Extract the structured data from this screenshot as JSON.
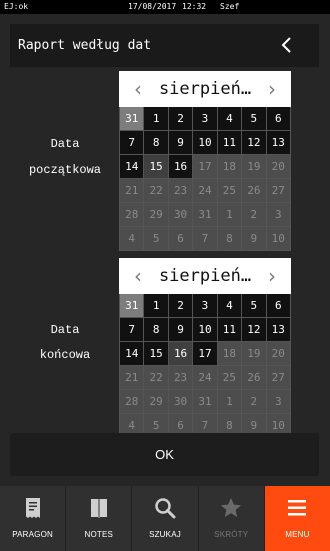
{
  "status": {
    "left": "EJ:ok",
    "date": "17/08/2017",
    "time": "12:32",
    "user": "Szef"
  },
  "header": {
    "title": "Raport według dat"
  },
  "labels": {
    "start_line1": "Data",
    "start_line2": "początkowa",
    "end_line1": "Data",
    "end_line2": "końcowa"
  },
  "calendar_start": {
    "month": "sierpień…",
    "days": [
      {
        "n": "31",
        "s": "sel"
      },
      {
        "n": "1",
        "s": "cur"
      },
      {
        "n": "2",
        "s": "cur"
      },
      {
        "n": "3",
        "s": "cur"
      },
      {
        "n": "4",
        "s": "cur"
      },
      {
        "n": "5",
        "s": "cur"
      },
      {
        "n": "6",
        "s": "cur"
      },
      {
        "n": "7",
        "s": "cur"
      },
      {
        "n": "8",
        "s": "cur"
      },
      {
        "n": "9",
        "s": "cur"
      },
      {
        "n": "10",
        "s": "cur"
      },
      {
        "n": "11",
        "s": "cur"
      },
      {
        "n": "12",
        "s": "cur"
      },
      {
        "n": "13",
        "s": "cur"
      },
      {
        "n": "14",
        "s": "cur"
      },
      {
        "n": "15",
        "s": "hl"
      },
      {
        "n": "16",
        "s": "cur"
      },
      {
        "n": "17",
        "s": "out"
      },
      {
        "n": "18",
        "s": "out"
      },
      {
        "n": "19",
        "s": "out"
      },
      {
        "n": "20",
        "s": "out"
      },
      {
        "n": "21",
        "s": "out"
      },
      {
        "n": "22",
        "s": "out"
      },
      {
        "n": "23",
        "s": "out"
      },
      {
        "n": "24",
        "s": "out"
      },
      {
        "n": "25",
        "s": "out"
      },
      {
        "n": "26",
        "s": "out"
      },
      {
        "n": "27",
        "s": "out"
      },
      {
        "n": "28",
        "s": "out"
      },
      {
        "n": "29",
        "s": "out"
      },
      {
        "n": "30",
        "s": "out"
      },
      {
        "n": "31",
        "s": "out"
      },
      {
        "n": "1",
        "s": "out"
      },
      {
        "n": "2",
        "s": "out"
      },
      {
        "n": "3",
        "s": "out"
      },
      {
        "n": "4",
        "s": "out"
      },
      {
        "n": "5",
        "s": "out"
      },
      {
        "n": "6",
        "s": "out"
      },
      {
        "n": "7",
        "s": "out"
      },
      {
        "n": "8",
        "s": "out"
      },
      {
        "n": "9",
        "s": "out"
      },
      {
        "n": "10",
        "s": "out"
      }
    ]
  },
  "calendar_end": {
    "month": "sierpień…",
    "days": [
      {
        "n": "31",
        "s": "sel"
      },
      {
        "n": "1",
        "s": "cur"
      },
      {
        "n": "2",
        "s": "cur"
      },
      {
        "n": "3",
        "s": "cur"
      },
      {
        "n": "4",
        "s": "cur"
      },
      {
        "n": "5",
        "s": "cur"
      },
      {
        "n": "6",
        "s": "cur"
      },
      {
        "n": "7",
        "s": "cur"
      },
      {
        "n": "8",
        "s": "cur"
      },
      {
        "n": "9",
        "s": "cur"
      },
      {
        "n": "10",
        "s": "cur"
      },
      {
        "n": "11",
        "s": "cur"
      },
      {
        "n": "12",
        "s": "cur"
      },
      {
        "n": "13",
        "s": "cur"
      },
      {
        "n": "14",
        "s": "cur"
      },
      {
        "n": "15",
        "s": "cur"
      },
      {
        "n": "16",
        "s": "hl"
      },
      {
        "n": "17",
        "s": "cur"
      },
      {
        "n": "18",
        "s": "out"
      },
      {
        "n": "19",
        "s": "out"
      },
      {
        "n": "20",
        "s": "out"
      },
      {
        "n": "21",
        "s": "out"
      },
      {
        "n": "22",
        "s": "out"
      },
      {
        "n": "23",
        "s": "out"
      },
      {
        "n": "24",
        "s": "out"
      },
      {
        "n": "25",
        "s": "out"
      },
      {
        "n": "26",
        "s": "out"
      },
      {
        "n": "27",
        "s": "out"
      },
      {
        "n": "28",
        "s": "out"
      },
      {
        "n": "29",
        "s": "out"
      },
      {
        "n": "30",
        "s": "out"
      },
      {
        "n": "31",
        "s": "out"
      },
      {
        "n": "1",
        "s": "out"
      },
      {
        "n": "2",
        "s": "out"
      },
      {
        "n": "3",
        "s": "out"
      },
      {
        "n": "4",
        "s": "out"
      },
      {
        "n": "5",
        "s": "out"
      },
      {
        "n": "6",
        "s": "out"
      },
      {
        "n": "7",
        "s": "out"
      },
      {
        "n": "8",
        "s": "out"
      },
      {
        "n": "9",
        "s": "out"
      },
      {
        "n": "10",
        "s": "out"
      }
    ]
  },
  "ok_label": "OK",
  "nav": [
    {
      "label": "PARAGON",
      "icon": "receipt-icon",
      "state": "normal"
    },
    {
      "label": "NOTES",
      "icon": "notebook-icon",
      "state": "normal"
    },
    {
      "label": "SZUKAJ",
      "icon": "search-icon",
      "state": "normal"
    },
    {
      "label": "SKRÓTY",
      "icon": "star-icon",
      "state": "disabled"
    },
    {
      "label": "MENU",
      "icon": "hamburger-icon",
      "state": "active"
    }
  ],
  "colors": {
    "accent": "#ff4a10",
    "background": "#262626"
  }
}
